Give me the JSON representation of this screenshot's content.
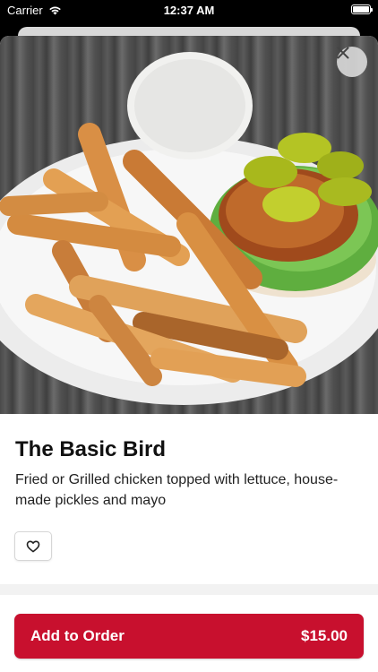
{
  "status_bar": {
    "carrier": "Carrier",
    "time": "12:37 AM"
  },
  "item": {
    "title": "The Basic Bird",
    "description": "Fried or Grilled chicken topped with lettuce, house-made pickles and mayo",
    "image_icon": "food-photo"
  },
  "actions": {
    "favorite_icon": "heart-outline-icon",
    "close_icon": "close-icon"
  },
  "footer": {
    "add_label": "Add to Order",
    "price": "$15.00"
  },
  "colors": {
    "brand": "#c8102e",
    "text": "#111111"
  }
}
